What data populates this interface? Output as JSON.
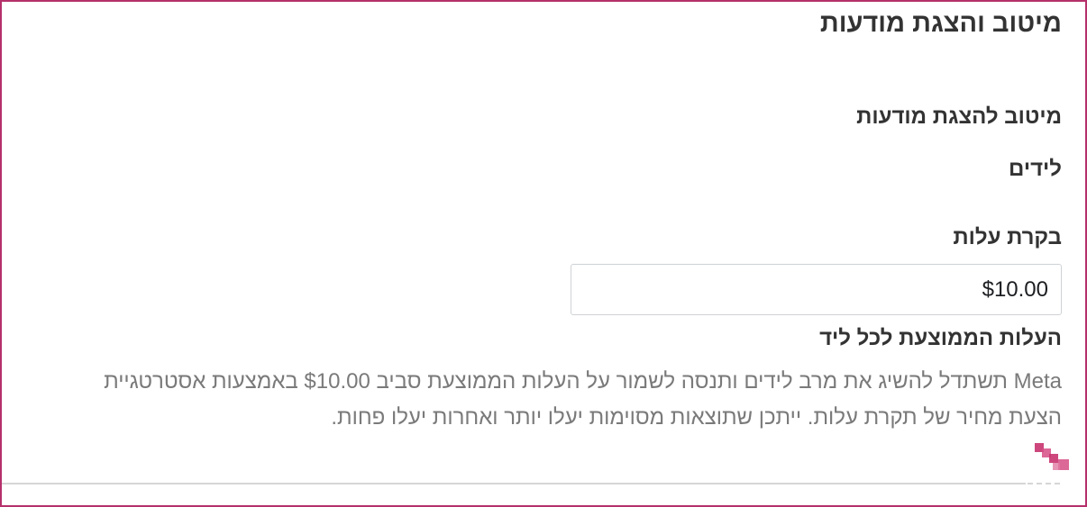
{
  "section": {
    "title": "מיטוב והצגת מודעות"
  },
  "fields": {
    "optimization_label": "מיטוב להצגת מודעות",
    "optimization_value": "לידים",
    "bid_label": "בקרת עלות",
    "bid_value": "$10.00",
    "avg_cost_label": "העלות הממוצעת לכל ליד",
    "avg_cost_description": "Meta תשתדל להשיג את מרב לידים ותנסה לשמור על העלות הממוצעת סביב $10.00 באמצעות אסטרטגיית הצעת מחיר של תקרת עלות. ייתכן שתוצאות מסוימות יעלו יותר ואחרות יעלו פחות."
  },
  "colors": {
    "frame_border": "#b5306a",
    "cursor": "#c8336f"
  },
  "icons": {
    "cursor": "loading-cursor-icon"
  }
}
